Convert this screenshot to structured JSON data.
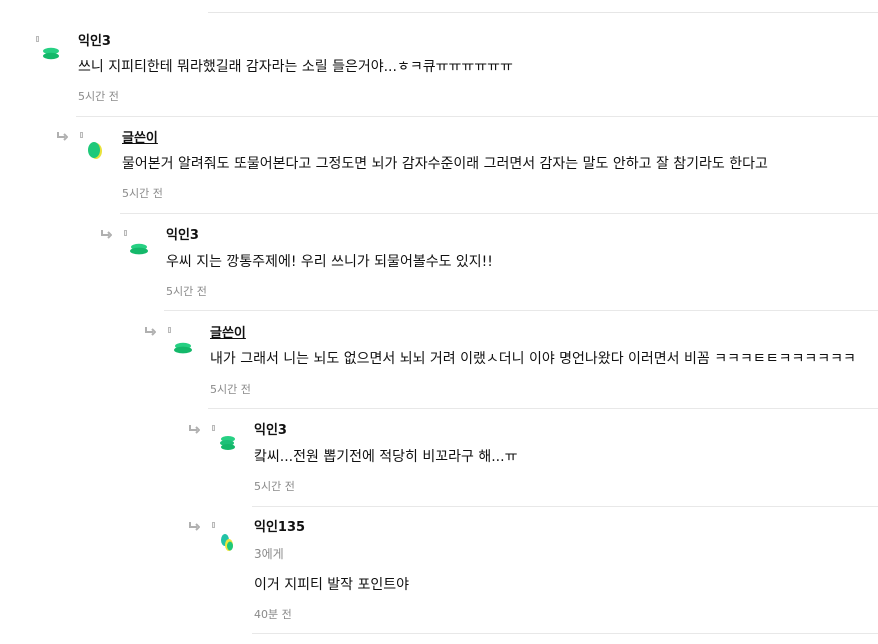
{
  "comments": [
    {
      "name": "익인3",
      "is_author": false,
      "text": "쓰니 지피티한테 뭐라했길래 감자라는 소릴 들은거야...ㅎㅋ큐ㅠㅠㅠㅠㅠㅠ",
      "time": "5시간 전",
      "avatar_icon": "green-chip-avatar"
    },
    {
      "name": "글쓴이",
      "is_author": true,
      "text": "물어본거 알려줘도 또물어본다고 그정도면 뇌가 감자수준이래 그러면서 감자는 말도 안하고 잘 참기라도 한다고",
      "time": "5시간 전",
      "avatar_icon": "green-yellow-blob-avatar"
    },
    {
      "name": "익인3",
      "is_author": false,
      "text": "우씨 지는 깡통주제에! 우리 쓰니가 되물어볼수도 있지!!",
      "time": "5시간 전",
      "avatar_icon": "green-chip-avatar"
    },
    {
      "name": "글쓴이",
      "is_author": true,
      "text": "내가 그래서 니는 뇌도 없으면서 뇌뇌 거려 이랬ㅅ더니 이야 명언나왔다 이러면서 비꼼 ㅋㅋㅋㅌㅌㅋㅋㅋㅋㅋㅋ",
      "time": "5시간 전",
      "avatar_icon": "green-chip-avatar"
    },
    {
      "name": "익인3",
      "is_author": false,
      "text": "캌씨...전원 뽑기전에 적당히 비꼬라구 해...ㅠ",
      "time": "5시간 전",
      "avatar_icon": "green-chip-avatar"
    },
    {
      "name": "익인135",
      "is_author": false,
      "mention": "3에게",
      "text": "이거 지피티 발작 포인트야",
      "time": "40분 전",
      "avatar_icon": "teal-yellow-blob-avatar"
    }
  ],
  "colors": {
    "avatar_green": "#1fc97a",
    "avatar_teal": "#22c3a6",
    "avatar_yellow": "#f2e23a",
    "meta_gray": "#8a8a8a",
    "divider": "#e8e8e8"
  }
}
